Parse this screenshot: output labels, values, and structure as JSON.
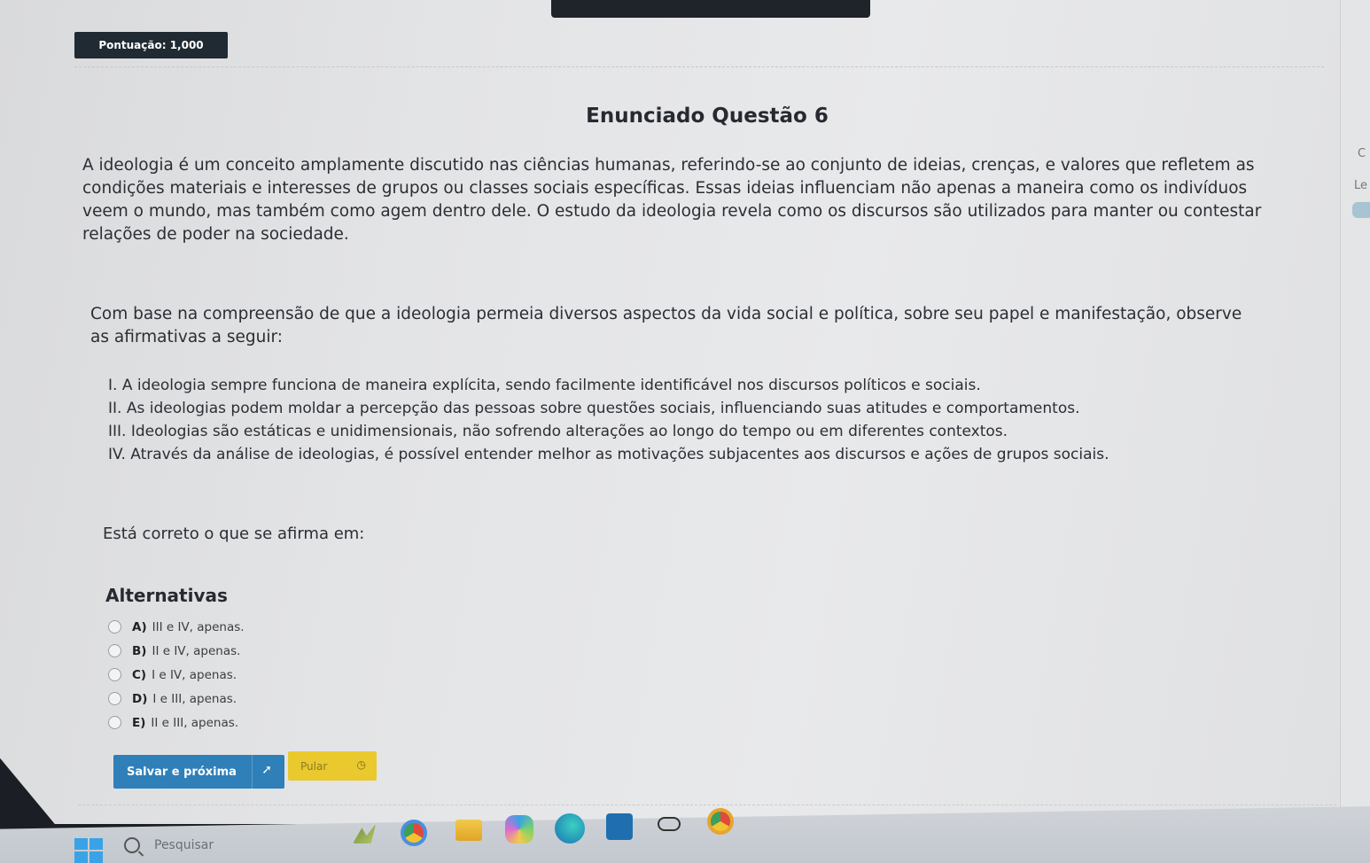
{
  "header": {
    "score_label": "Pontuação: 1,000"
  },
  "question": {
    "title": "Enunciado Questão 6",
    "paragraph1": "A ideologia é um conceito amplamente discutido nas ciências humanas, referindo-se ao conjunto de ideias, crenças, e valores que refletem as condições materiais e interesses de grupos ou classes sociais específicas. Essas ideias influenciam não apenas a maneira como os indivíduos veem o mundo, mas também como agem dentro dele. O estudo da ideologia revela como os discursos são utilizados para manter ou contestar relações de poder na sociedade.",
    "paragraph2": "Com base na compreensão de que a ideologia permeia diversos aspectos da vida social e política, sobre seu papel e manifestação, observe as afirmativas a seguir:",
    "statements": [
      "I. A ideologia sempre funciona de maneira explícita, sendo facilmente identificável nos discursos políticos e sociais.",
      "II. As ideologias podem moldar a percepção das pessoas sobre questões sociais, influenciando suas atitudes e comportamentos.",
      "III. Ideologias são estáticas e unidimensionais, não sofrendo alterações ao longo do tempo ou em diferentes contextos.",
      "IV. Através da análise de ideologias, é possível entender melhor as motivações subjacentes aos discursos e ações de grupos sociais."
    ],
    "prompt": "Está correto o que se afirma em:"
  },
  "alternatives": {
    "title": "Alternativas",
    "items": [
      {
        "letter": "A)",
        "text": "III e IV, apenas."
      },
      {
        "letter": "B)",
        "text": "II e IV, apenas."
      },
      {
        "letter": "C)",
        "text": "I e IV, apenas."
      },
      {
        "letter": "D)",
        "text": "I e III, apenas."
      },
      {
        "letter": "E)",
        "text": "II e III, apenas."
      }
    ]
  },
  "actions": {
    "save_label": "Salvar e próxima",
    "skip_label": "Pular"
  },
  "side": {
    "letter_c": "C",
    "letter_le": "Le"
  },
  "taskbar": {
    "search_placeholder": "Pesquisar",
    "icons": [
      "windows-icon",
      "search-icon",
      "widgets-icon",
      "chrome-icon",
      "file-explorer-icon",
      "copilot-icon",
      "edge-icon",
      "store-icon",
      "game-icon",
      "chrome-profile-icon"
    ]
  },
  "colors": {
    "primary_button": "#2f7fb8",
    "skip_button": "#e9c92e",
    "score_badge": "#1f2a33"
  }
}
